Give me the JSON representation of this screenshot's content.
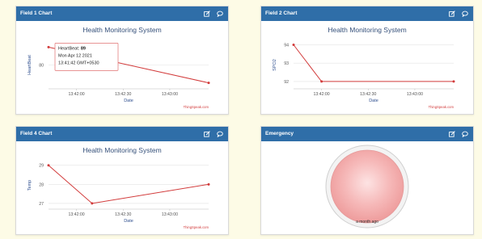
{
  "widgets": {
    "field1": {
      "title": "Field 1 Chart"
    },
    "field2": {
      "title": "Field 2 Chart"
    },
    "field4": {
      "title": "Field 4 Chart"
    },
    "emergency": {
      "title": "Emergency",
      "timestamp": "a month ago",
      "lamp_color": "#f2a4a4"
    }
  },
  "icons": {
    "edit": "edit-icon",
    "comment": "comment-icon"
  },
  "colors": {
    "header": "#2f6ea8",
    "line": "#d23b3b",
    "background": "#fdfbe6"
  },
  "chart_data": [
    {
      "type": "line",
      "title": "Health Monitoring System",
      "xlabel": "Date",
      "ylabel": "HeartBeat",
      "x_ticks": [
        "13:42:00",
        "13:42:30",
        "13:43:00"
      ],
      "y_ticks": [
        80
      ],
      "x": [
        "13:41:42",
        "13:43:25"
      ],
      "values": [
        89,
        71
      ],
      "credit": "ThingSpeak.com",
      "tooltip": {
        "label": "HeartBeat:",
        "value": "89",
        "date": "Mon Apr 12 2021",
        "time": "13:41:42 GMT+0530"
      }
    },
    {
      "type": "line",
      "title": "Health Monitoring System",
      "xlabel": "Date",
      "ylabel": "SPO2",
      "x_ticks": [
        "13:42:00",
        "13:42:30",
        "13:43:00"
      ],
      "y_ticks": [
        94,
        93,
        92
      ],
      "x": [
        "13:41:42",
        "13:42:00",
        "13:43:25"
      ],
      "values": [
        94,
        92,
        92
      ],
      "credit": "ThingSpeak.com"
    },
    {
      "type": "line",
      "title": "Health Monitoring System",
      "xlabel": "Date",
      "ylabel": "Temp",
      "x_ticks": [
        "13:42:00",
        "13:42:30",
        "13:43:00"
      ],
      "y_ticks": [
        29,
        28,
        27
      ],
      "x": [
        "13:41:42",
        "13:42:10",
        "13:43:25"
      ],
      "values": [
        29,
        27,
        28
      ],
      "credit": "ThingSpeak.com"
    }
  ]
}
